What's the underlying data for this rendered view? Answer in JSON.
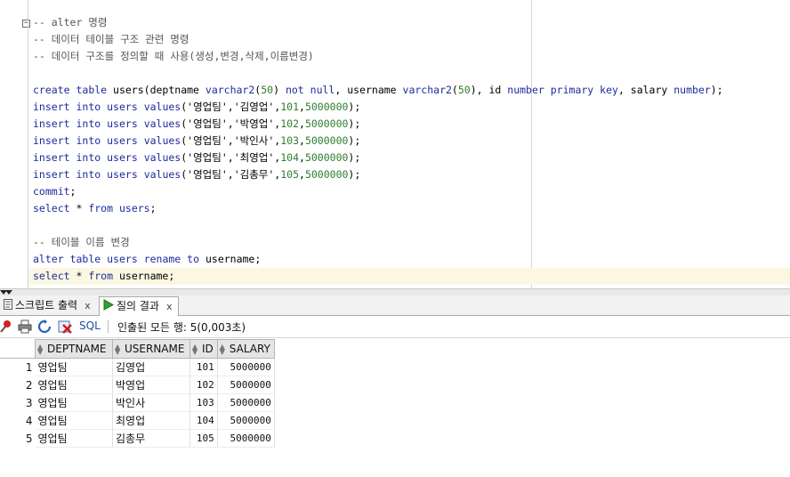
{
  "editor": {
    "lines": [
      {
        "type": "comment",
        "text": "-- alter 명령"
      },
      {
        "type": "comment",
        "text": "-- 데이터 테이블 구조 관련 명령"
      },
      {
        "type": "comment",
        "text": "-- 데이터 구조를 정의할 때 사용(생성,변경,삭제,이름변경)"
      },
      {
        "type": "blank",
        "text": ""
      },
      {
        "type": "create",
        "parts": [
          "create",
          " ",
          "table",
          " users(deptname ",
          "varchar2",
          "(",
          "50",
          ") ",
          "not",
          " ",
          "null",
          ", username ",
          "varchar2",
          "(",
          "50",
          "), id ",
          "number",
          " ",
          "primary",
          " ",
          "key",
          ", salary ",
          "number",
          ");"
        ]
      },
      {
        "type": "insert",
        "values": [
          "'영업팀'",
          "'김영업'",
          "101",
          "5000000"
        ]
      },
      {
        "type": "insert",
        "values": [
          "'영업팀'",
          "'박영업'",
          "102",
          "5000000"
        ]
      },
      {
        "type": "insert",
        "values": [
          "'영업팀'",
          "'박인사'",
          "103",
          "5000000"
        ]
      },
      {
        "type": "insert",
        "values": [
          "'영업팀'",
          "'최영업'",
          "104",
          "5000000"
        ]
      },
      {
        "type": "insert",
        "values": [
          "'영업팀'",
          "'김총무'",
          "105",
          "5000000"
        ]
      },
      {
        "type": "plain_kw",
        "kw": "commit",
        "rest": ";"
      },
      {
        "type": "select",
        "table": "users"
      },
      {
        "type": "blank",
        "text": ""
      },
      {
        "type": "comment",
        "text": "-- 테이블 이름 변경"
      },
      {
        "type": "alter",
        "table": "users",
        "newname": "username"
      },
      {
        "type": "select",
        "table": "username",
        "current": true
      }
    ],
    "keywords": {
      "insert": "insert",
      "into": "into",
      "values": "values",
      "select": "select",
      "from": "from",
      "alter": "alter",
      "table": "table",
      "rename": "rename",
      "to": "to",
      "users": "users"
    }
  },
  "tabs": [
    {
      "label": "스크립트 출력",
      "close": "x",
      "active": false,
      "icon": "script-output-icon"
    },
    {
      "label": "질의 결과",
      "close": "x",
      "active": true,
      "icon": "run-query-icon"
    }
  ],
  "toolbar": {
    "sql_label": "SQL",
    "status": "인출된 모든 행: 5(0,003초)"
  },
  "grid": {
    "columns": [
      "DEPTNAME",
      "USERNAME",
      "ID",
      "SALARY"
    ],
    "rows": [
      {
        "n": "1",
        "deptname": "영업팀",
        "username": "김영업",
        "id": "101",
        "salary": "5000000"
      },
      {
        "n": "2",
        "deptname": "영업팀",
        "username": "박영업",
        "id": "102",
        "salary": "5000000"
      },
      {
        "n": "3",
        "deptname": "영업팀",
        "username": "박인사",
        "id": "103",
        "salary": "5000000"
      },
      {
        "n": "4",
        "deptname": "영업팀",
        "username": "최영업",
        "id": "104",
        "salary": "5000000"
      },
      {
        "n": "5",
        "deptname": "영업팀",
        "username": "김총무",
        "id": "105",
        "salary": "5000000"
      }
    ]
  },
  "colors": {
    "keyword": "#1c2b9b",
    "number": "#2e7d2e",
    "comment": "#555555",
    "current_line": "#fbf7e2"
  }
}
